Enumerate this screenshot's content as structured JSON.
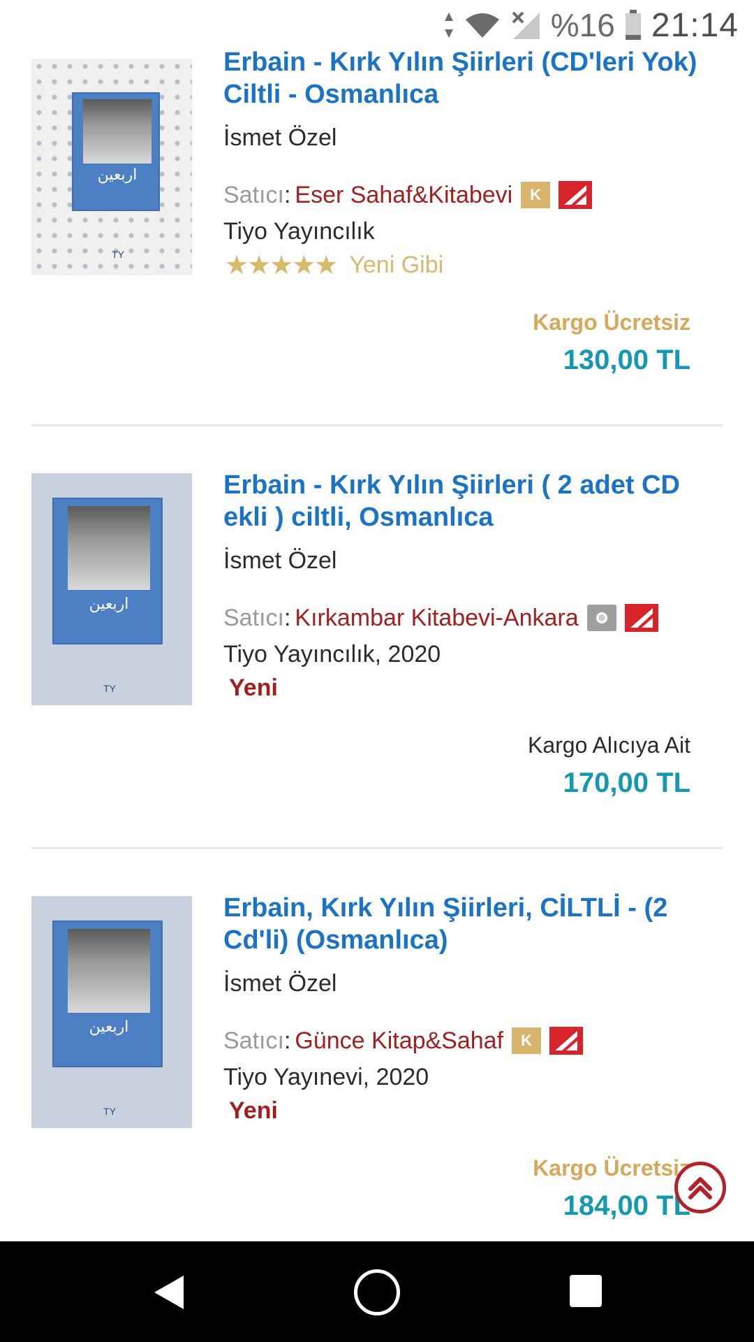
{
  "status_bar": {
    "battery_percent": "%16",
    "time": "21:14"
  },
  "listings": [
    {
      "title": "Erbain - Kırk Yılın Şiirleri (CD'leri Yok) Ciltli - Osmanlıca",
      "author": "İsmet Özel",
      "seller_label": "Satıcı",
      "seller_name": "Eser Sahaf&Kitabevi",
      "seller_badge": "K",
      "publisher": "Tiyo Yayıncılık",
      "rating_stars": 5,
      "condition": "Yeni Gibi",
      "shipping": "Kargo Ücretsiz",
      "price": "130,00 TL"
    },
    {
      "title": "Erbain - Kırk Yılın Şiirleri ( 2 adet CD ekli ) ciltli, Osmanlıca",
      "author": "İsmet Özel",
      "seller_label": "Satıcı",
      "seller_name": "Kırkambar Kitabevi-Ankara",
      "seller_badge": "O",
      "publisher": "Tiyo Yayıncılık, 2020",
      "condition": "Yeni",
      "shipping": "Kargo Alıcıya Ait",
      "price": "170,00 TL"
    },
    {
      "title": "Erbain, Kırk Yılın Şiirleri, CİLTLİ - (2 Cd'li) (Osmanlıca)",
      "author": "İsmet Özel",
      "seller_label": "Satıcı",
      "seller_name": "Günce Kitap&Sahaf",
      "seller_badge": "K",
      "publisher": "Tiyo Yayınevi, 2020",
      "condition": "Yeni",
      "shipping": "Kargo Ücretsiz",
      "price": "184,00 TL"
    }
  ],
  "cover_arabic": "اربعين",
  "icons": {
    "scroll_top": "chevron-up-circle-icon",
    "nav_back": "back-triangle-icon",
    "nav_home": "home-circle-icon",
    "nav_recent": "recent-apps-square-icon"
  },
  "colors": {
    "title": "#1a73c6",
    "seller": "#a31f1f",
    "price": "#1499b0",
    "free_shipping": "#d7a85a"
  }
}
